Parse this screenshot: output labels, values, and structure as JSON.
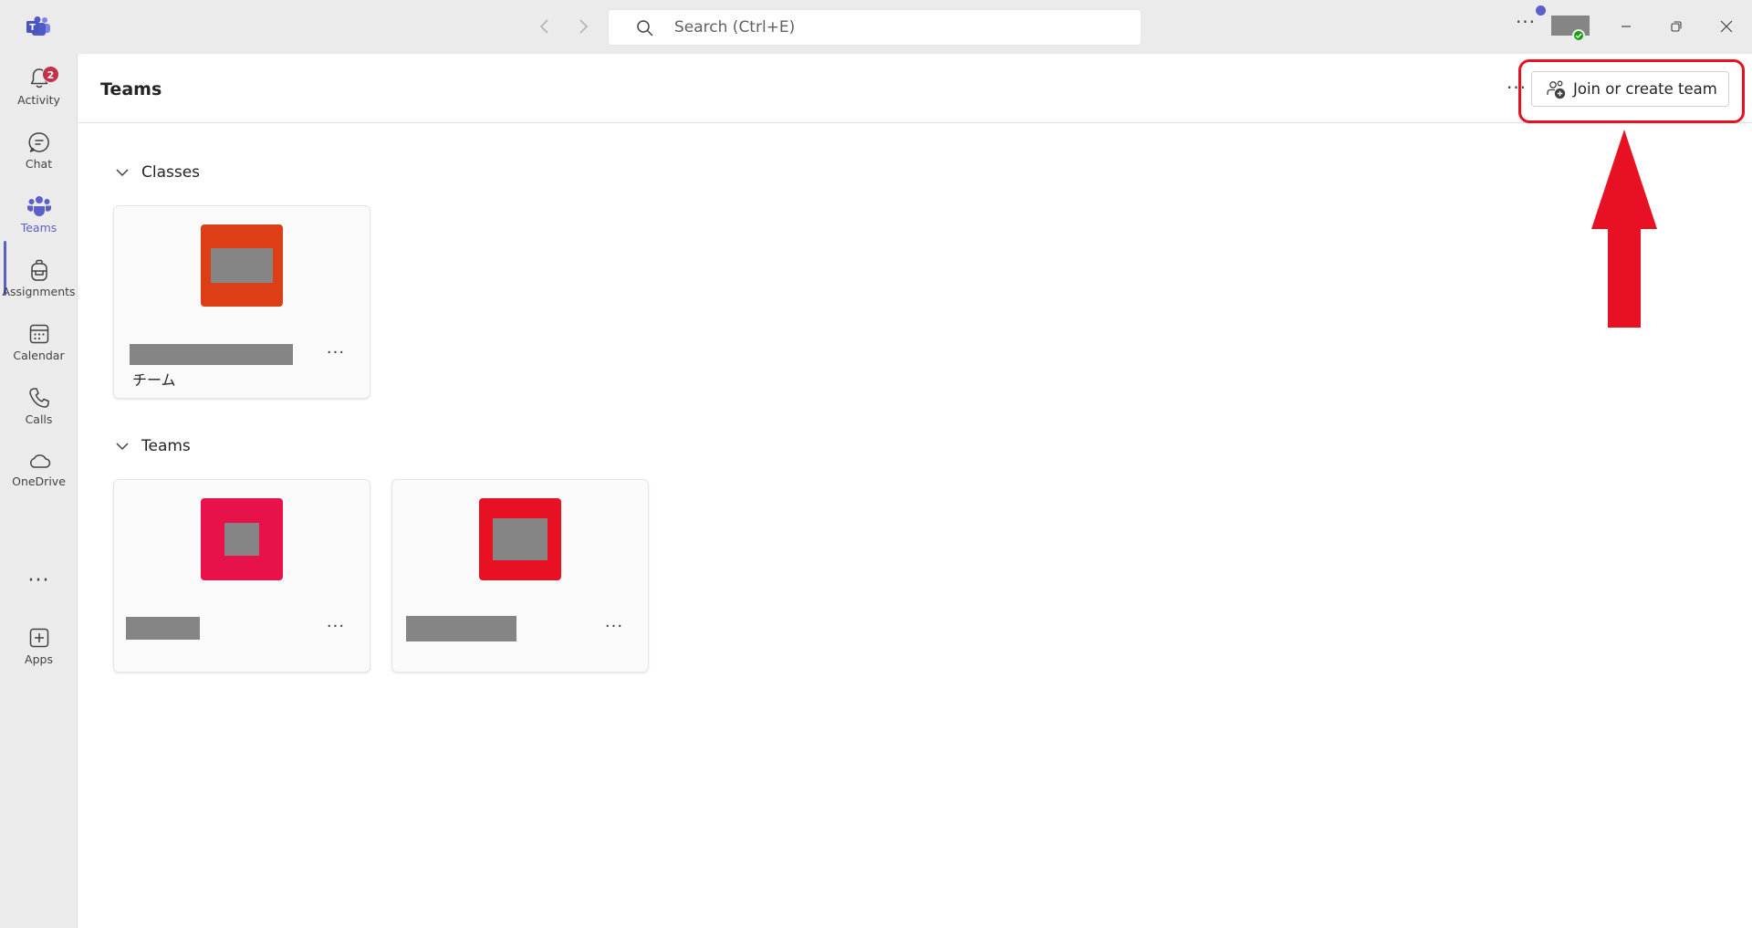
{
  "titlebar": {
    "search_placeholder": "Search (Ctrl+E)",
    "more_label": "···",
    "accent_color": "#5b5fc7"
  },
  "rail": {
    "items": [
      {
        "label": "Activity",
        "icon": "bell-icon",
        "badge": "2"
      },
      {
        "label": "Chat",
        "icon": "chat-icon"
      },
      {
        "label": "Teams",
        "icon": "teams-icon",
        "active": true
      },
      {
        "label": "Assignments",
        "icon": "backpack-icon"
      },
      {
        "label": "Calendar",
        "icon": "calendar-icon"
      },
      {
        "label": "Calls",
        "icon": "phone-icon"
      },
      {
        "label": "OneDrive",
        "icon": "cloud-icon"
      },
      {
        "label": "Apps",
        "icon": "add-app-icon"
      }
    ],
    "more_label": "···"
  },
  "main": {
    "title": "Teams",
    "more_label": "···",
    "join_button_label": "Join or create team",
    "sections": [
      {
        "label": "Classes",
        "cards": [
          {
            "avatar_color": "#dc3e15",
            "subtitle": "チーム",
            "more_label": "···"
          }
        ]
      },
      {
        "label": "Teams",
        "cards": [
          {
            "avatar_color": "#e8124b",
            "more_label": "···"
          },
          {
            "avatar_color": "#e81123",
            "more_label": "···"
          }
        ]
      }
    ]
  },
  "annotation": {
    "color": "#e81123"
  }
}
